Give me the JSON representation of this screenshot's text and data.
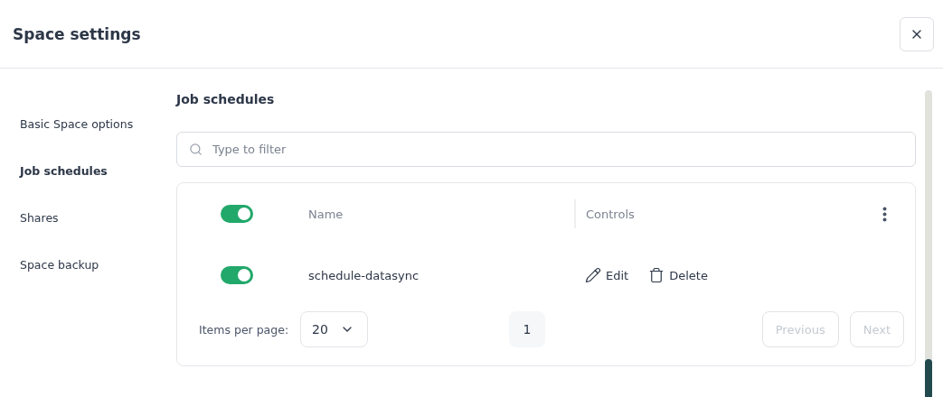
{
  "window": {
    "title": "Space settings"
  },
  "sidebar": {
    "items": [
      {
        "label": "Basic Space options",
        "selected": false
      },
      {
        "label": "Job schedules",
        "selected": true
      },
      {
        "label": "Shares",
        "selected": false
      },
      {
        "label": "Space backup",
        "selected": false
      }
    ]
  },
  "section": {
    "title": "Job schedules"
  },
  "filter": {
    "placeholder": "Type to filter"
  },
  "table": {
    "select_all_on": true,
    "columns": [
      "Name",
      "Controls"
    ],
    "rows": [
      {
        "on": true,
        "name": "schedule-datasync",
        "actions": [
          {
            "kind": "edit",
            "label": "Edit"
          },
          {
            "kind": "delete",
            "label": "Delete"
          }
        ]
      }
    ]
  },
  "pagination": {
    "items_label": "Items per page:",
    "page_size": "20",
    "pages": [
      {
        "label": "1",
        "selected": true
      }
    ],
    "previous": {
      "label": "Previous",
      "disabled": true
    },
    "next": {
      "label": "Next",
      "disabled": true
    }
  }
}
